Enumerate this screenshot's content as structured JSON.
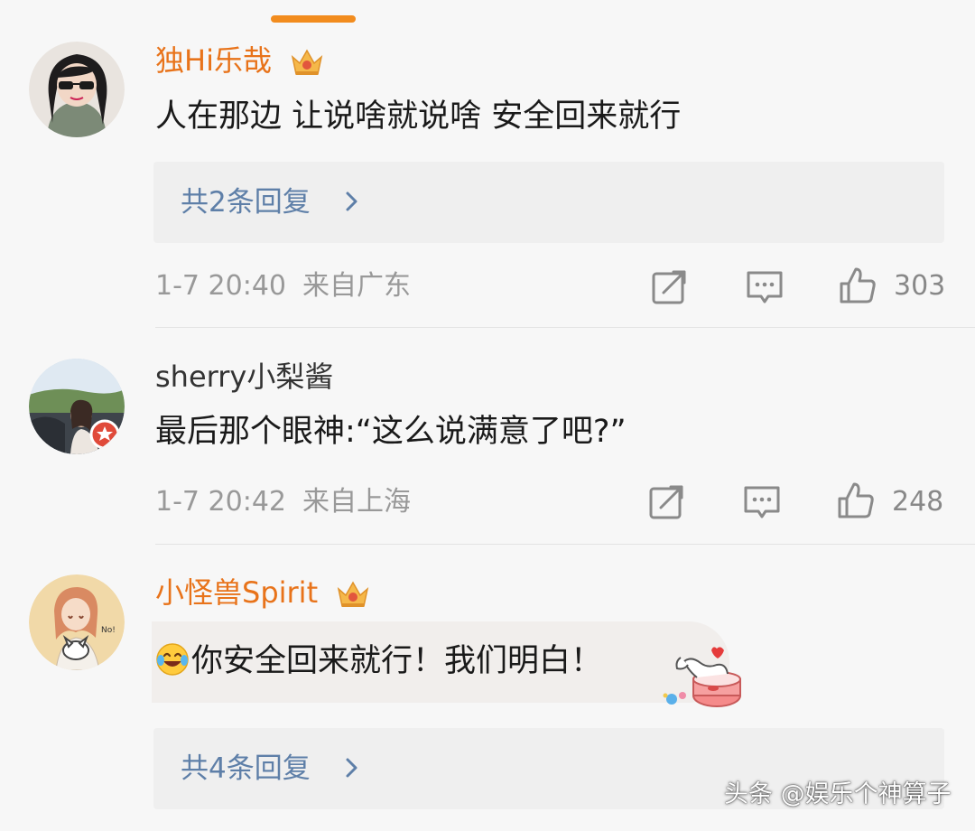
{
  "colors": {
    "vip_name": "#e8731a",
    "reply_link": "#5e7fa8",
    "meta": "#999999",
    "indicator": "#f28c1e"
  },
  "comments": [
    {
      "username": "独Hi乐哉",
      "vip": true,
      "text": "人在那边 让说啥就说啥 安全回来就行",
      "replies": "共2条回复",
      "time": "1-7 20:40",
      "location": "来自广东",
      "likes": "303"
    },
    {
      "username": "sherry小梨酱",
      "vip": false,
      "text": "最后那个眼神:“这么说满意了吧?”",
      "time": "1-7 20:42",
      "location": "来自上海",
      "likes": "248"
    },
    {
      "username": "小怪兽Spirit",
      "vip": true,
      "text": "你安全回来就行！我们明白！",
      "emoji": "laugh-cry-emoji",
      "replies": "共4条回复"
    }
  ],
  "icons": [
    "share-icon",
    "comment-icon",
    "like-icon",
    "crown-icon",
    "chevron-right-icon"
  ],
  "watermark": "头条 @娱乐个神算子"
}
